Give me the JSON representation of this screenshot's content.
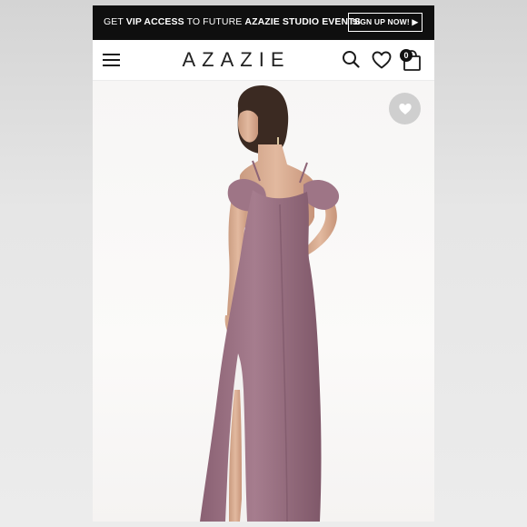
{
  "promo_banner": {
    "prefix": "GET ",
    "vip": "VIP ACCESS",
    "middle": " TO FUTURE ",
    "brand_events": "AZAZIE STUDIO EVENTS",
    "button_label": "SIGN UP NOW! ▶"
  },
  "header": {
    "logo": "AZAZIE",
    "cart_count": "0",
    "icons": [
      "menu-icon",
      "search-icon",
      "heart-icon",
      "shopping-bag-icon"
    ]
  },
  "product": {
    "image_subject": "model in mauve off-shoulder ruffle gown with side slit, back view",
    "wishlist_icon": "heart-icon"
  },
  "colors": {
    "banner_bg": "#0f0f0f",
    "dress": "#9d7485",
    "wishlist_button": "#cfcfcf"
  }
}
